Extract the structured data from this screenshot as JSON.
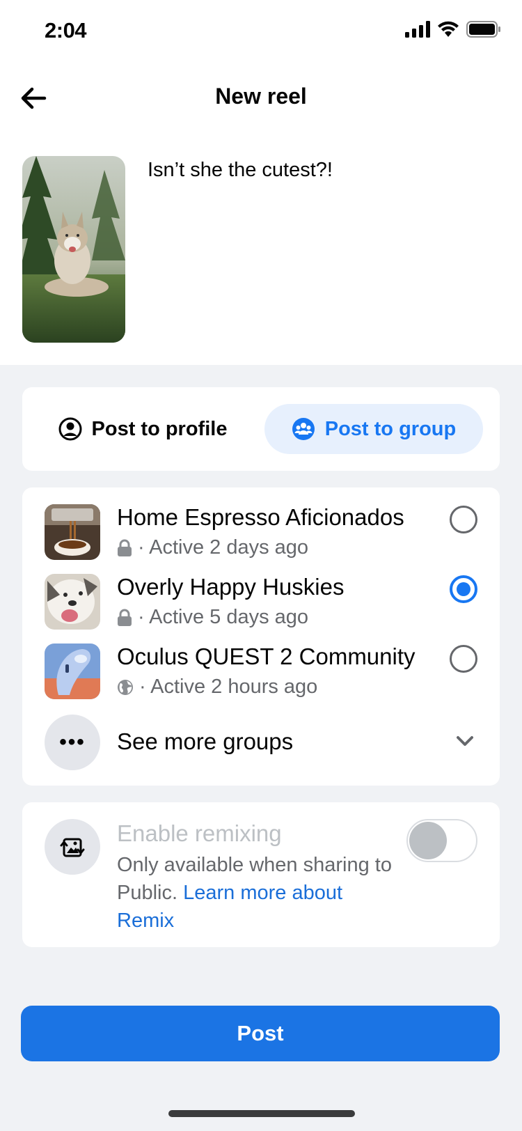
{
  "status": {
    "time": "2:04"
  },
  "header": {
    "title": "New reel"
  },
  "caption": "Isn’t she the cutest?!",
  "segments": {
    "profile_label": "Post to profile",
    "group_label": "Post to group",
    "selected": "group"
  },
  "groups": [
    {
      "name": "Home Espresso Aficionados",
      "privacy_icon": "lock-icon",
      "activity": "· Active 2 days ago",
      "selected": false
    },
    {
      "name": "Overly Happy Huskies",
      "privacy_icon": "lock-icon",
      "activity": "· Active 5 days ago",
      "selected": true
    },
    {
      "name": "Oculus QUEST 2 Community",
      "privacy_icon": "globe-icon",
      "activity": "· Active 2 hours ago",
      "selected": false
    }
  ],
  "see_more": {
    "label": "See more groups",
    "icon": "more-icon"
  },
  "remix": {
    "title": "Enable remixing",
    "desc": "Only available when sharing to Public.",
    "link": "Learn more about Remix",
    "enabled": false
  },
  "post_button": "Post",
  "colors": {
    "accent": "#1877f2",
    "segment_bg": "#e7f0fd",
    "page_bg": "#f0f2f5"
  }
}
